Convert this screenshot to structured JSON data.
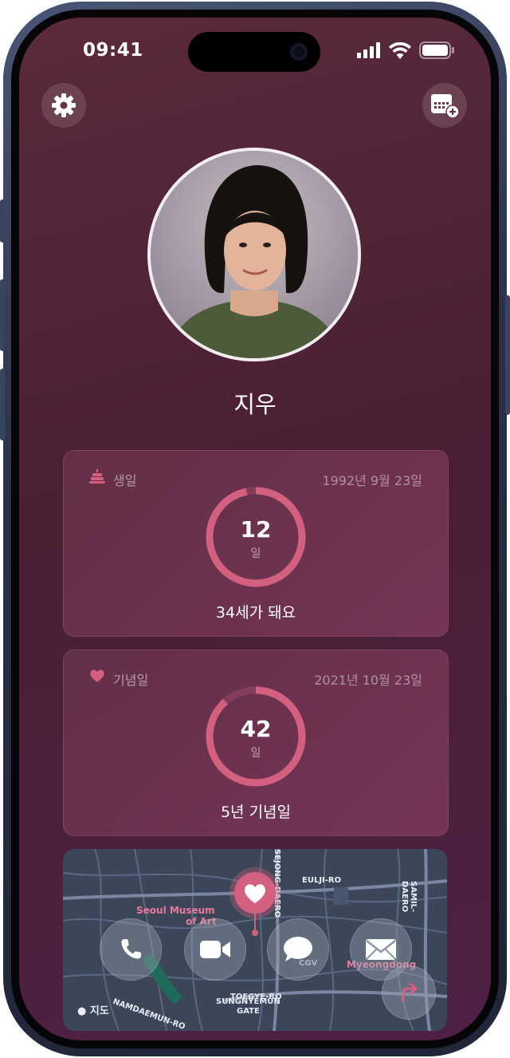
{
  "status_bar": {
    "time": "09:41"
  },
  "profile": {
    "name": "지우"
  },
  "birthday_card": {
    "label": "생일",
    "date": "1992년 9월 23일",
    "days": "12",
    "unit": "일",
    "subtitle": "34세가 돼요",
    "progress": 0.967
  },
  "anniversary_card": {
    "label": "기념일",
    "date": "2021년 10월 23일",
    "days": "42",
    "unit": "일",
    "subtitle": "5년 기념일",
    "progress": 0.885
  },
  "map": {
    "labels": {
      "museum_line1": "Seoul Museum",
      "museum_line2": "of Art",
      "myeongdong": "Myeongdong",
      "eulji": "EULJI-RO",
      "toegye": "TOEGYE-RO",
      "samil": "SAMIL-DAERO",
      "sejong": "SEJONG-DAERO",
      "sungnyemun1": "SUNGNYEMUN",
      "sungnyemun2": "GATE",
      "namdaemun": "NAMDAEMUN-RO",
      "cgv": "CGV",
      "brand": "지도"
    }
  },
  "actions": {
    "call_icon": "phone-icon",
    "video_icon": "video-camera-icon",
    "message_icon": "message-bubble-icon",
    "mail_icon": "envelope-icon",
    "directions_icon": "directions-arrow-icon"
  },
  "colors": {
    "accent": "#d4607f",
    "background": "#4a1f34"
  }
}
